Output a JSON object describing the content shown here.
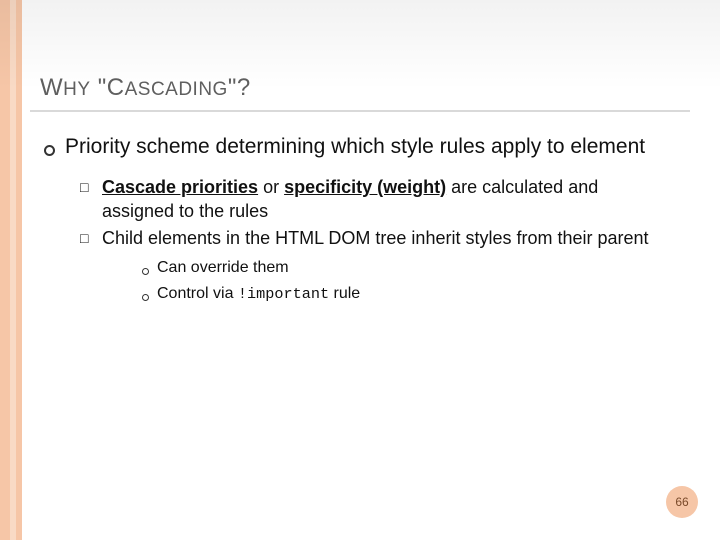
{
  "title": {
    "w1_cap": "W",
    "w1_rest": "HY",
    "quote_open": " \"",
    "w2_cap": "C",
    "w2_rest": "ASCADING",
    "tail": "\"?"
  },
  "lvl1": {
    "text": "Priority scheme determining which style rules apply to element"
  },
  "lvl2": [
    {
      "lead_bold": "Cascade priorities",
      "mid1": " or ",
      "mid_bold": "specificity (weight)",
      "tail": " are calculated and assigned to the rules"
    },
    {
      "plain": "Child elements in the HTML DOM tree inherit styles from their parent"
    }
  ],
  "lvl3": [
    {
      "text": "Can override them"
    },
    {
      "pre": "Control via ",
      "code": "!important",
      "post": " rule"
    }
  ],
  "page_number": "66"
}
